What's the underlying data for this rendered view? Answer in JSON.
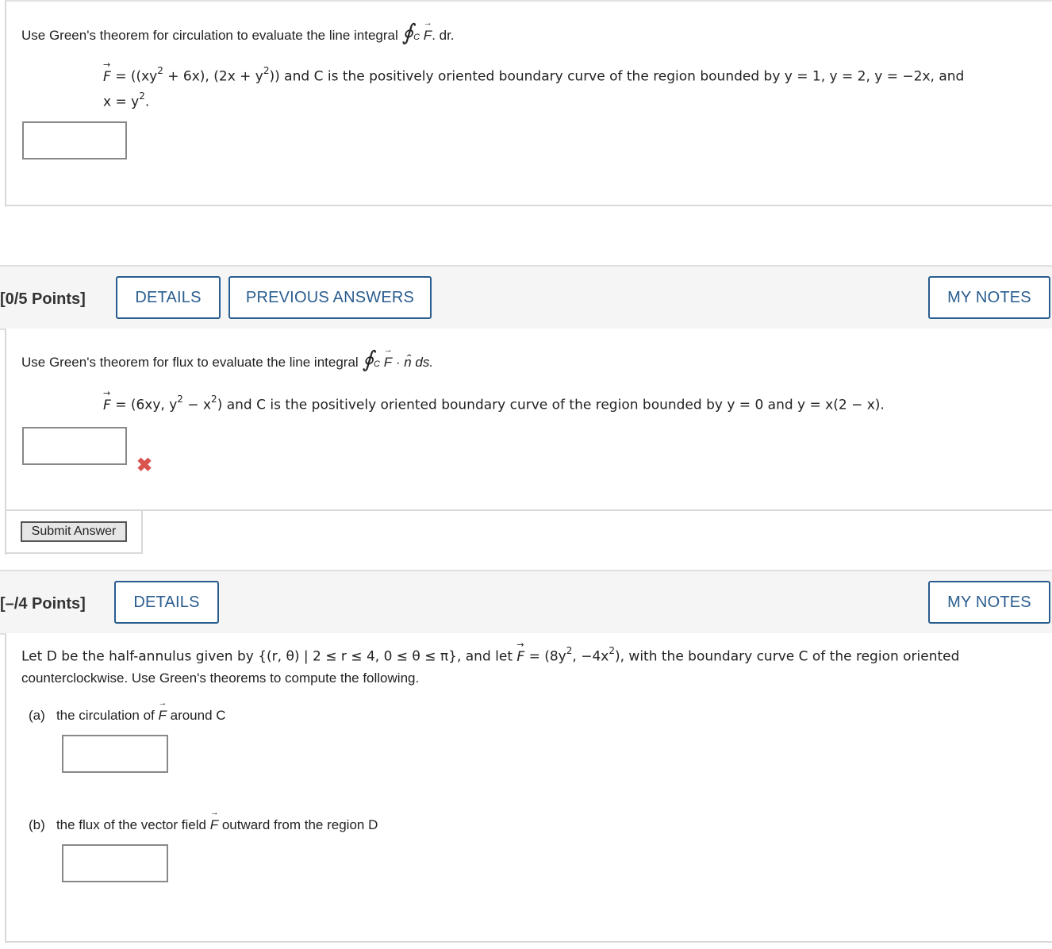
{
  "q1": {
    "intro": "Use Green's theorem for circulation to evaluate the line integral",
    "integral_tail": ". dr.",
    "field_text": "= ((xy",
    "field_rest": " + 6x), (2x + y",
    "field_rest2": ")) and C is the positively oriented boundary curve of the region bounded by y = 1, y = 2, y = −2x, and",
    "line2": "x = y",
    "line2_end": "."
  },
  "q2": {
    "points": "[0/5 Points]",
    "details_label": "DETAILS",
    "prev_answers_label": "PREVIOUS ANSWERS",
    "mynotes_label": "MY NOTES",
    "intro": "Use Green's theorem for flux to evaluate the line integral",
    "integral_tail": " · n̂ ds.",
    "field_a": "= (6xy, y",
    "field_b": " − x",
    "field_c": ") and C is the positively oriented boundary curve of the region bounded by y = 0 and y = x(2 − x).",
    "status_icon": "incorrect-x-icon",
    "submit_label": "Submit Answer"
  },
  "q3": {
    "points": "[–/4 Points]",
    "details_label": "DETAILS",
    "mynotes_label": "MY NOTES",
    "line1_a": "Let D be the half-annulus given by {(r, θ) | 2 ≤ r ≤ 4, 0 ≤ θ ≤ π}, and let",
    "line1_b": "= (8y",
    "line1_c": ", −4x",
    "line1_d": "), with the boundary curve C of the region oriented",
    "line2": "counterclockwise. Use Green's theorems to compute the following.",
    "part_a_label": "(a)",
    "part_a_text_a": "the circulation of",
    "part_a_text_b": "around C",
    "part_b_label": "(b)",
    "part_b_text_a": "the flux of the vector field",
    "part_b_text_b": "outward from the region D"
  },
  "common": {
    "F": "F",
    "sup2": "2",
    "C": "C"
  },
  "colors": {
    "accent": "#2a5d8f",
    "error": "#d9534f"
  }
}
